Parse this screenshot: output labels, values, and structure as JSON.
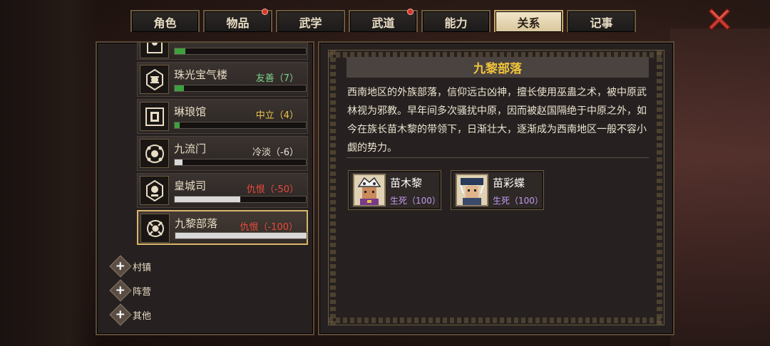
{
  "tabs": [
    {
      "label": "角色",
      "active": false,
      "badge": false
    },
    {
      "label": "物品",
      "active": false,
      "badge": true
    },
    {
      "label": "武学",
      "active": false,
      "badge": false
    },
    {
      "label": "武道",
      "active": false,
      "badge": true
    },
    {
      "label": "能力",
      "active": false,
      "badge": false
    },
    {
      "label": "关系",
      "active": true,
      "badge": false
    },
    {
      "label": "记事",
      "active": false,
      "badge": false
    }
  ],
  "factions": [
    {
      "name": "",
      "relation": "",
      "relation_class": "good",
      "bar_fraction": 0.08,
      "bar_color": "#3fa040"
    },
    {
      "name": "珠光宝气楼",
      "relation": "友善（7）",
      "relation_class": "good",
      "bar_fraction": 0.07,
      "bar_color": "#3fa040"
    },
    {
      "name": "琳琅馆",
      "relation": "中立（4）",
      "relation_class": "neutral",
      "bar_fraction": 0.04,
      "bar_color": "#3fa040"
    },
    {
      "name": "九流门",
      "relation": "冷淡（-6）",
      "relation_class": "cold",
      "bar_fraction": 0.06,
      "bar_color": "#d8d8d8"
    },
    {
      "name": "皇城司",
      "relation": "仇恨（-50）",
      "relation_class": "hate",
      "bar_fraction": 0.5,
      "bar_color": "#d8d8d8"
    },
    {
      "name": "九黎部落",
      "relation": "仇恨（-100）",
      "relation_class": "hate",
      "bar_fraction": 1.0,
      "bar_color": "#d8d8d8"
    }
  ],
  "categories": [
    {
      "label": "村镇"
    },
    {
      "label": "阵营"
    },
    {
      "label": "其他"
    }
  ],
  "detail": {
    "title": "九黎部落",
    "description": "西南地区的外族部落，信仰远古凶神，擅长使用巫蛊之术，被中原武林视为邪教。早年间多次骚扰中原，因而被赵国隔绝于中原之外，如今在族长苗木黎的带领下，日渐壮大，逐渐成为西南地区一般不容小觑的势力。",
    "members": [
      {
        "name": "苗木黎",
        "status": "生死（100）"
      },
      {
        "name": "苗彩蝶",
        "status": "生死（100）"
      }
    ]
  },
  "colors": {
    "accent_gold": "#f0c43a",
    "good": "#7fd38a",
    "neutral": "#e8c24a",
    "hate": "#e84a3a",
    "status_purple": "#c59bf0"
  },
  "icons": {
    "close": "close-x-icon",
    "expand": "plus-icon"
  }
}
